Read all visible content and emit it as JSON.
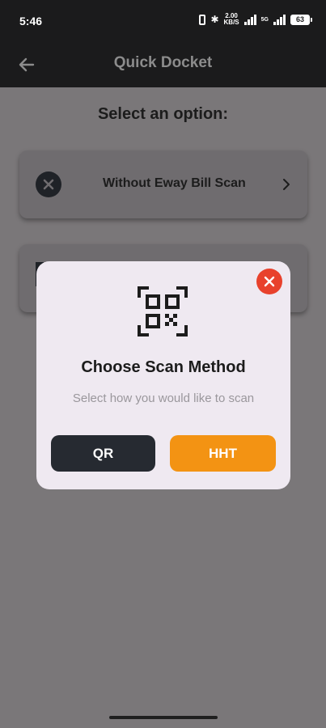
{
  "status_bar": {
    "time": "5:46",
    "network_speed_top": "2.00",
    "network_speed_bottom": "KB/S",
    "signal_label": "5G",
    "battery": "63"
  },
  "app_bar": {
    "title": "Quick Docket"
  },
  "content": {
    "heading": "Select an option:",
    "options": [
      {
        "label": "Without Eway Bill Scan",
        "icon": "x-circle-icon"
      },
      {
        "label": "",
        "icon": ""
      }
    ]
  },
  "dialog": {
    "title": "Choose Scan Method",
    "subtitle": "Select how you would like to scan",
    "qr_button": "QR",
    "hht_button": "HHT",
    "close_icon": "close-icon",
    "scan_icon": "qr-scan-icon"
  },
  "colors": {
    "accent": "#f39313",
    "close": "#e8412c",
    "dark_button": "#262a31"
  }
}
